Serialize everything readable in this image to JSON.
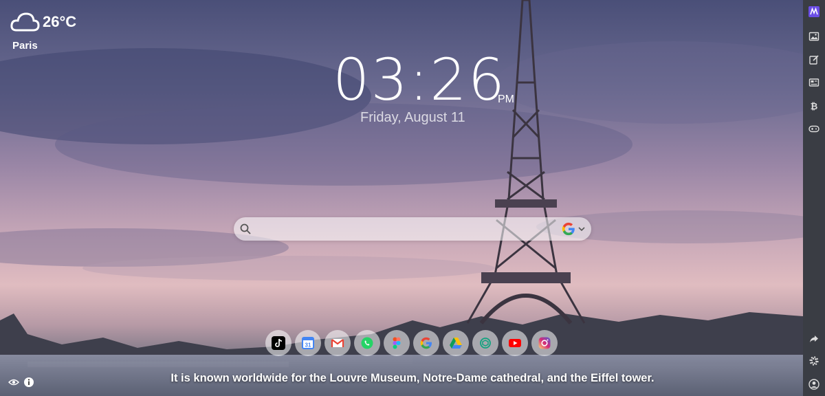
{
  "weather": {
    "temperature": "26°C",
    "city": "Paris"
  },
  "clock": {
    "time": "03:26",
    "ampm": "PM",
    "date": "Friday, August 11"
  },
  "search": {
    "placeholder": "",
    "engine_icon": "google-g-icon"
  },
  "dock": {
    "apps": [
      {
        "name": "tiktok",
        "icon": "tiktok-icon",
        "color": "#000000"
      },
      {
        "name": "google-calendar",
        "icon": "calendar-icon",
        "color": "#4285F4"
      },
      {
        "name": "gmail",
        "icon": "gmail-icon",
        "color": "#EA4335"
      },
      {
        "name": "whatsapp",
        "icon": "whatsapp-icon",
        "color": "#25D366"
      },
      {
        "name": "figma",
        "icon": "figma-icon",
        "color": "#F24E1E"
      },
      {
        "name": "google",
        "icon": "google-icon",
        "color": "#4285F4"
      },
      {
        "name": "google-drive",
        "icon": "drive-icon",
        "color": "#0F9D58"
      },
      {
        "name": "chatgpt",
        "icon": "chatgpt-icon",
        "color": "#10A37F"
      },
      {
        "name": "youtube",
        "icon": "youtube-icon",
        "color": "#FF0000"
      },
      {
        "name": "instagram",
        "icon": "instagram-icon",
        "color": "#E1306C"
      }
    ]
  },
  "quote": {
    "text": "It is known worldwide for the Louvre Museum, Notre-Dame cathedral, and the Eiffel tower."
  },
  "sidebar": {
    "top": [
      "logo-icon",
      "image-icon",
      "note-icon",
      "news-icon",
      "bitcoin-icon",
      "gamepad-icon"
    ],
    "bottom": [
      "share-icon",
      "gear-icon",
      "user-icon"
    ],
    "accent": "#6b4ee6"
  },
  "colors": {
    "sidebar_bg": "#3a3d44"
  }
}
